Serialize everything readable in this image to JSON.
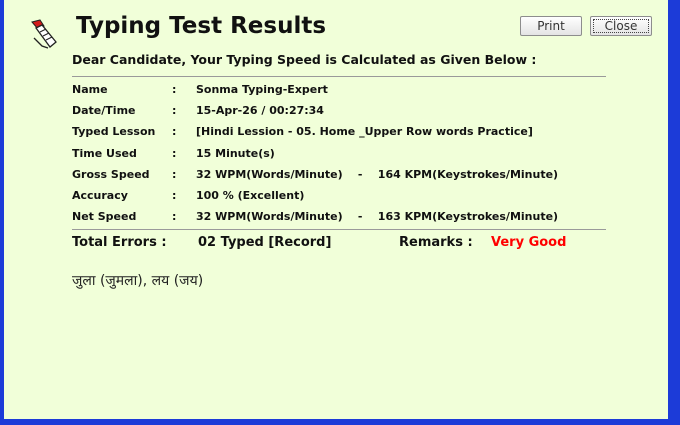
{
  "header": {
    "title": "Typing Test Results",
    "print_label": "Print",
    "close_label": "Close"
  },
  "subtitle": "Dear Candidate, Your Typing Speed is Calculated as Given Below :",
  "separator": ":",
  "details": [
    {
      "label": "Name",
      "value": "Sonma Typing-Expert"
    },
    {
      "label": "Date/Time",
      "value": "15-Apr-26 / 00:27:34"
    },
    {
      "label": "Typed Lesson",
      "value": "[Hindi Lession - 05. Home _Upper Row words Practice]"
    },
    {
      "label": "Time Used",
      "value": "15 Minute(s)"
    },
    {
      "label": "Gross Speed",
      "value": "32 WPM(Words/Minute)    -    164 KPM(Keystrokes/Minute)"
    },
    {
      "label": "Accuracy",
      "value": "100 % (Excellent)"
    },
    {
      "label": "Net Speed",
      "value": "32 WPM(Words/Minute)    -    163 KPM(Keystrokes/Minute)"
    }
  ],
  "summary": {
    "errors_label": "Total Errors :",
    "errors_value": "02 Typed [Record]",
    "remarks_label": "Remarks :",
    "remarks_value": "Very Good"
  },
  "errors_list": "जुला (जुमला), लय (जय)",
  "colors": {
    "background": "#f1ffd9",
    "frame": "#1c3bd8",
    "remarks": "#ff0000"
  }
}
